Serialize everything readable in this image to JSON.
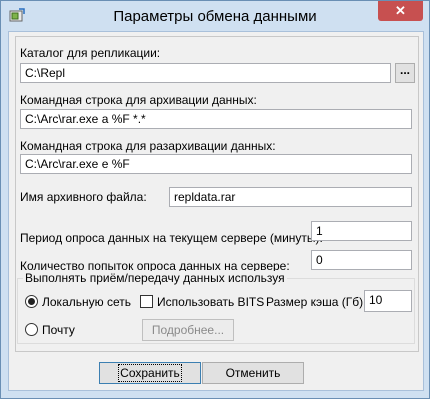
{
  "window": {
    "title": "Параметры обмена данными",
    "close_label": "✕"
  },
  "replication": {
    "label": "Каталог для репликации:",
    "value": "C:\\Repl",
    "browse_label": "..."
  },
  "archive_cmd": {
    "label": "Командная строка для архивации данных:",
    "value": "C:\\Arc\\rar.exe a %F *.*"
  },
  "unarchive_cmd": {
    "label": "Командная строка для разархивации данных:",
    "value": "C:\\Arc\\rar.exe e %F"
  },
  "archive_file": {
    "label": "Имя архивного файла:",
    "value": "repldata.rar"
  },
  "poll_period": {
    "label": "Период опроса данных на текущем сервере (минуты):",
    "value": "1"
  },
  "poll_attempts": {
    "label": "Количество попыток опроса данных на сервере:",
    "value": "0"
  },
  "transfer": {
    "group_label": "Выполнять приём/передачу данных используя",
    "local_network_label": "Локальную сеть",
    "local_network_selected": true,
    "mail_label": "Почту",
    "mail_selected": false,
    "bits_label": "Использовать BITS",
    "bits_checked": false,
    "cache_label": "Размер кэша (Гб):",
    "cache_value": "10",
    "details_label": "Подробнее..."
  },
  "footer": {
    "save_label": "Сохранить",
    "cancel_label": "Отменить"
  }
}
